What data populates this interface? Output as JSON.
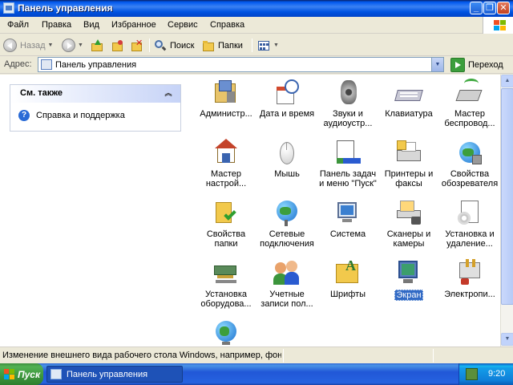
{
  "window": {
    "title": "Панель управления",
    "controls": {
      "minimize": "_",
      "maximize": "❐",
      "close": "✕"
    }
  },
  "menu": [
    "Файл",
    "Правка",
    "Вид",
    "Избранное",
    "Сервис",
    "Справка"
  ],
  "toolbar": {
    "back": "Назад",
    "search": "Поиск",
    "folders": "Папки"
  },
  "address": {
    "label": "Адрес:",
    "value": "Панель управления",
    "go": "Переход"
  },
  "taskpane": {
    "section_title": "См. также",
    "links": [
      {
        "label": "Справка и поддержка",
        "icon": "help-icon"
      }
    ]
  },
  "items": [
    {
      "label": "Администр...",
      "icon": "admin-tools-icon"
    },
    {
      "label": "Дата и время",
      "icon": "date-time-icon"
    },
    {
      "label": "Звуки и аудиоустр...",
      "icon": "sounds-icon"
    },
    {
      "label": "Клавиатура",
      "icon": "keyboard-icon"
    },
    {
      "label": "Мастер беспровод...",
      "icon": "wireless-wizard-icon"
    },
    {
      "label": "Мастер настрой...",
      "icon": "network-wizard-icon"
    },
    {
      "label": "Мышь",
      "icon": "mouse-icon"
    },
    {
      "label": "Панель задач и меню \"Пуск\"",
      "icon": "taskbar-icon"
    },
    {
      "label": "Принтеры и факсы",
      "icon": "printers-icon"
    },
    {
      "label": "Свойства обозревателя",
      "icon": "internet-options-icon"
    },
    {
      "label": "Свойства папки",
      "icon": "folder-options-icon"
    },
    {
      "label": "Сетевые подключения",
      "icon": "network-connections-icon"
    },
    {
      "label": "Система",
      "icon": "system-icon"
    },
    {
      "label": "Сканеры и камеры",
      "icon": "scanners-icon"
    },
    {
      "label": "Установка и удаление...",
      "icon": "add-remove-icon"
    },
    {
      "label": "Установка оборудова...",
      "icon": "add-hardware-icon"
    },
    {
      "label": "Учетные записи пол...",
      "icon": "user-accounts-icon"
    },
    {
      "label": "Шрифты",
      "icon": "fonts-icon"
    },
    {
      "label": "Экран",
      "icon": "display-icon",
      "selected": true
    },
    {
      "label": "Электропи...",
      "icon": "power-options-icon"
    },
    {
      "label": "",
      "icon": "regional-options-icon"
    }
  ],
  "status": {
    "text": "Изменение внешнего вида рабочего стола Windows, например, фонс"
  },
  "taskbar": {
    "start": "Пуск",
    "task": "Панель управления",
    "clock": "9:20"
  },
  "colors": {
    "titlebar": "#0058ee",
    "selection": "#316ac5",
    "start": "#3c953c",
    "taskbar": "#2157d7"
  }
}
